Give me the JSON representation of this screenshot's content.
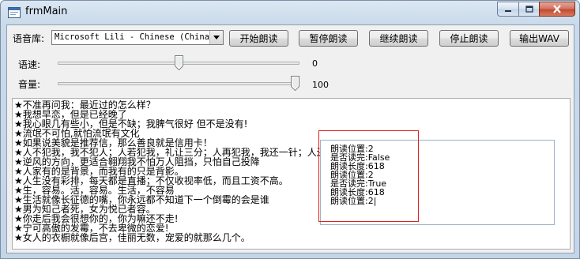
{
  "window": {
    "title": "frmMain"
  },
  "toolbar": {
    "voice_label": "语音库:",
    "voice_selected": "Microsoft Lili - Chinese (China)",
    "start_label": "开始朗读",
    "pause_label": "暂停朗读",
    "resume_label": "继续朗读",
    "stop_label": "停止朗读",
    "export_label": "输出WAV"
  },
  "rate": {
    "label": "语速:",
    "value": "0",
    "level": 0.5
  },
  "volume": {
    "label": "音量:",
    "value": "100",
    "level": 1.0
  },
  "text_lines": [
    "★不准再问我：最近过的怎么样？",
    "★我想早恋，但是已经晚了",
    "★我心眼几有些小，但是不缺；我脾气很好 但不是没有!",
    "★流氓不可怕,就怕流氓有文化",
    "★如果说美貌是推荐信，那么善良就是信用卡！",
    "★人不犯我，我不犯人；人若犯我，礼让三分；人再犯我，我还一针；人还",
    "★逆风的方向，更适合翱翔我不怕万人阻挡，只怕自己投降",
    "★人家有的是背景，而我有的只是背影。",
    "★人生没有彩排，每天都是直播；不仅收视率低，而且工资不高。",
    "★生，容易。活，容易。生活，不容易",
    "★生活就像长征德的嘴，你永远都不知道下一个倒霉的会是谁",
    "★男为知己者死，女为悦已者容。",
    "★你走后我会很想你的，你为嘛还不走!",
    "★宁可高傲的发霉，不去卑微的恋爱!",
    "★女人的衣橱就像后宫，佳丽无数，宠爱的就那么几个。"
  ],
  "status_lines": [
    "朗读位置:2",
    "是否读完:False",
    "朗读长度:618",
    "朗读位置:2",
    "是否读完:True",
    "朗读长度:618",
    "朗读位置:2|"
  ]
}
